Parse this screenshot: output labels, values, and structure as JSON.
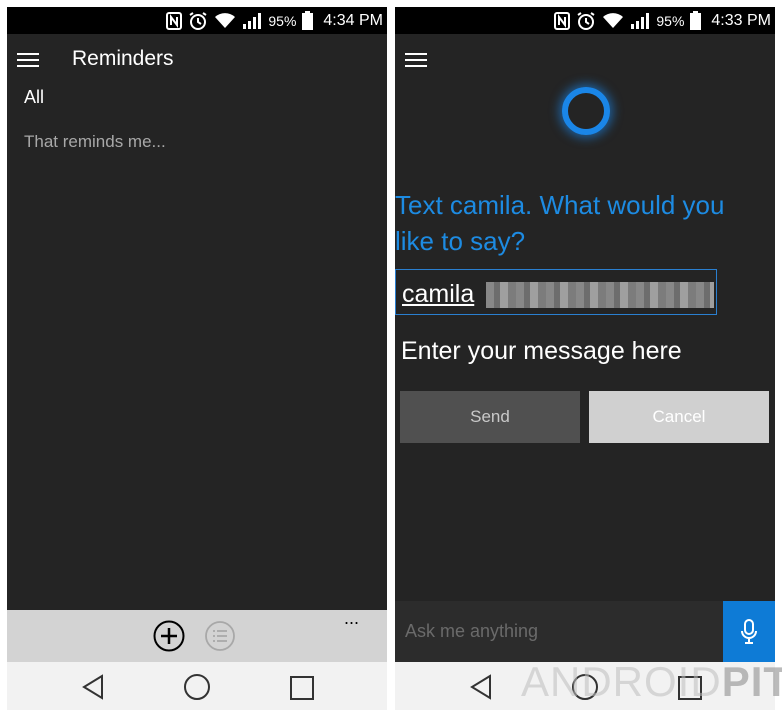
{
  "left_screen": {
    "status_bar": {
      "battery": "95%",
      "time": "4:34 PM"
    },
    "header": {
      "title": "Reminders"
    },
    "filter": "All",
    "empty_text": "That reminds me...",
    "app_bar": {
      "more": "..."
    }
  },
  "right_screen": {
    "status_bar": {
      "battery": "95%",
      "time": "4:33 PM"
    },
    "prompt": "Text camila. What would you like to say?",
    "recipient": {
      "name": "camila"
    },
    "message": "Enter your message here",
    "buttons": {
      "send": "Send",
      "cancel": "Cancel"
    },
    "ask_bar": {
      "placeholder": "Ask me anything"
    }
  },
  "watermark": {
    "part1": "ANDROID",
    "part2": "PIT"
  },
  "colors": {
    "accent": "#1d8be2",
    "mic": "#0e7bd6",
    "background": "#242424"
  }
}
